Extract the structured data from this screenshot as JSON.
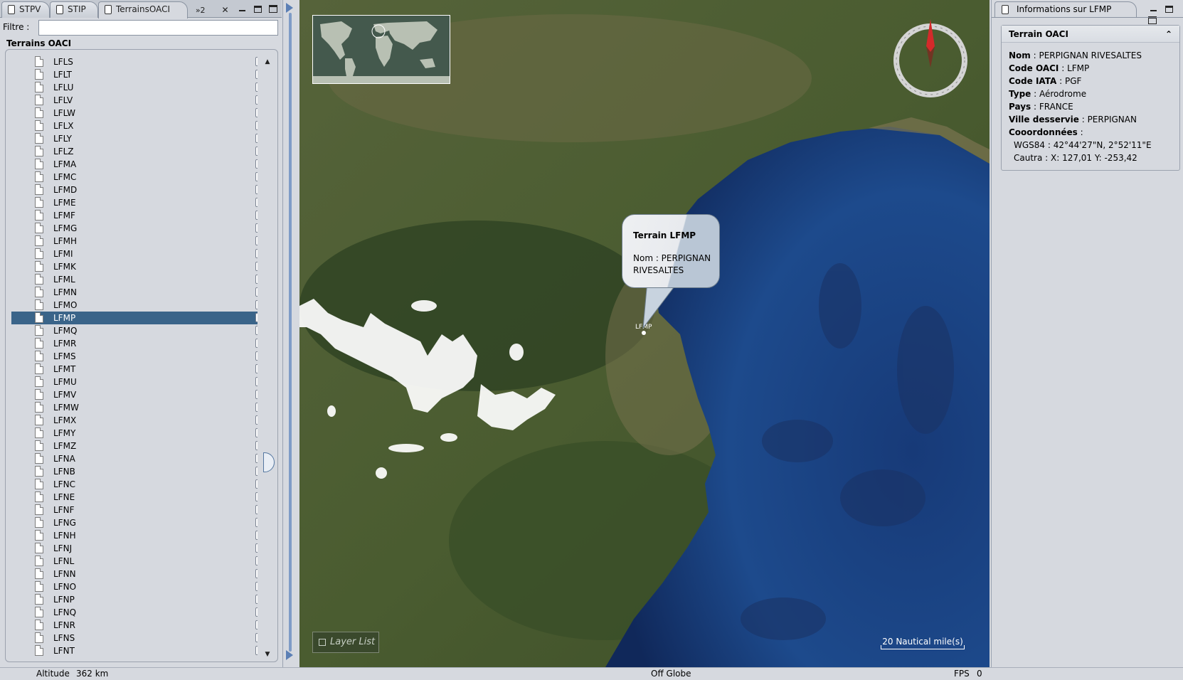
{
  "left_tabs": [
    {
      "label": "STPV"
    },
    {
      "label": "STIP"
    },
    {
      "label": "TerrainsOACI"
    }
  ],
  "left_tools": {
    "overflow": "»2",
    "close": "✕"
  },
  "filter": {
    "label": "Filtre :",
    "value": "",
    "placeholder": ""
  },
  "list_title": "Terrains OACI",
  "airfields": [
    {
      "code": "LFLS",
      "checked": false
    },
    {
      "code": "LFLT",
      "checked": false
    },
    {
      "code": "LFLU",
      "checked": false
    },
    {
      "code": "LFLV",
      "checked": false
    },
    {
      "code": "LFLW",
      "checked": false
    },
    {
      "code": "LFLX",
      "checked": false
    },
    {
      "code": "LFLY",
      "checked": false
    },
    {
      "code": "LFLZ",
      "checked": false
    },
    {
      "code": "LFMA",
      "checked": false
    },
    {
      "code": "LFMC",
      "checked": false
    },
    {
      "code": "LFMD",
      "checked": false
    },
    {
      "code": "LFME",
      "checked": false
    },
    {
      "code": "LFMF",
      "checked": false
    },
    {
      "code": "LFMG",
      "checked": false
    },
    {
      "code": "LFMH",
      "checked": false
    },
    {
      "code": "LFMI",
      "checked": false
    },
    {
      "code": "LFMK",
      "checked": false
    },
    {
      "code": "LFML",
      "checked": false
    },
    {
      "code": "LFMN",
      "checked": false
    },
    {
      "code": "LFMO",
      "checked": false
    },
    {
      "code": "LFMP",
      "checked": true,
      "selected": true
    },
    {
      "code": "LFMQ",
      "checked": false
    },
    {
      "code": "LFMR",
      "checked": false
    },
    {
      "code": "LFMS",
      "checked": false
    },
    {
      "code": "LFMT",
      "checked": false
    },
    {
      "code": "LFMU",
      "checked": false
    },
    {
      "code": "LFMV",
      "checked": false
    },
    {
      "code": "LFMW",
      "checked": false
    },
    {
      "code": "LFMX",
      "checked": false
    },
    {
      "code": "LFMY",
      "checked": false
    },
    {
      "code": "LFMZ",
      "checked": false
    },
    {
      "code": "LFNA",
      "checked": false
    },
    {
      "code": "LFNB",
      "checked": false
    },
    {
      "code": "LFNC",
      "checked": false
    },
    {
      "code": "LFNE",
      "checked": false
    },
    {
      "code": "LFNF",
      "checked": false
    },
    {
      "code": "LFNG",
      "checked": false
    },
    {
      "code": "LFNH",
      "checked": false
    },
    {
      "code": "LFNJ",
      "checked": false
    },
    {
      "code": "LFNL",
      "checked": false
    },
    {
      "code": "LFNN",
      "checked": false
    },
    {
      "code": "LFNO",
      "checked": false
    },
    {
      "code": "LFNP",
      "checked": false
    },
    {
      "code": "LFNQ",
      "checked": false
    },
    {
      "code": "LFNR",
      "checked": false
    },
    {
      "code": "LFNS",
      "checked": false
    },
    {
      "code": "LFNT",
      "checked": false
    }
  ],
  "map": {
    "layer_list_label": "Layer List",
    "scale_label": "20 Nautical mile(s)",
    "marker_label": "LFMP",
    "balloon": {
      "title": "Terrain LFMP",
      "body": "Nom : PERPIGNAN RIVESALTES"
    },
    "colors": {
      "sea": "#1a3f7a",
      "land": "#4a5a2e",
      "snow": "#ffffff",
      "compass_needle": "#d42a2a"
    }
  },
  "right_panel": {
    "tab_label": "Informations sur LFMP",
    "section_title": "Terrain OACI",
    "fields": {
      "nom_label": "Nom",
      "nom_value": " : PERPIGNAN RIVESALTES",
      "oaci_label": "Code OACI",
      "oaci_value": " : LFMP",
      "iata_label": "Code IATA",
      "iata_value": " : PGF",
      "type_label": "Type",
      "type_value": " : Aérodrome",
      "pays_label": "Pays",
      "pays_value": " : FRANCE",
      "ville_label": "Ville desservie",
      "ville_value": " : PERPIGNAN",
      "coord_label": "Cooordonnées",
      "coord_value": " :",
      "wgs84": "WGS84 : 42°44'27\"N, 2°52'11\"E",
      "cautra": "Cautra : X:  127,01 Y: -253,42"
    }
  },
  "status": {
    "altitude_label": "Altitude",
    "altitude_value": "362 km",
    "globe_status": "Off Globe",
    "fps_label": "FPS",
    "fps_value": "0"
  }
}
